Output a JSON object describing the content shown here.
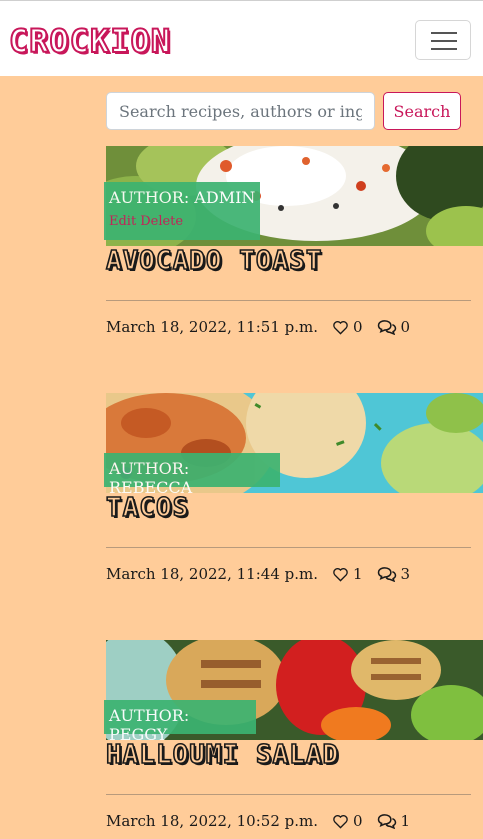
{
  "brand": {
    "name": "CROCKION"
  },
  "search": {
    "placeholder": "Search recipes, authors or ingr",
    "button_label": "Search"
  },
  "posts": [
    {
      "author": "AUTHOR: ADMIN",
      "edit_label": "Edit",
      "delete_label": "Delete",
      "title": "AVOCADO TOAST",
      "date": "March 18, 2022, 11:51 p.m.",
      "likes": "0",
      "comments": "0"
    },
    {
      "author": "AUTHOR: REBECCA",
      "title": "TACOS",
      "date": "March 18, 2022, 11:44 p.m.",
      "likes": "1",
      "comments": "3"
    },
    {
      "author": "AUTHOR: PEGGY",
      "title": "HALLOUMI SALAD",
      "date": "March 18, 2022, 10:52 p.m.",
      "likes": "0",
      "comments": "1"
    }
  ],
  "icons": {
    "like": "heart-icon",
    "comment": "comments-icon",
    "menu": "hamburger-icon"
  },
  "colors": {
    "accent": "#c8175a",
    "background": "#ffcc99",
    "badge": "#3cb371"
  }
}
